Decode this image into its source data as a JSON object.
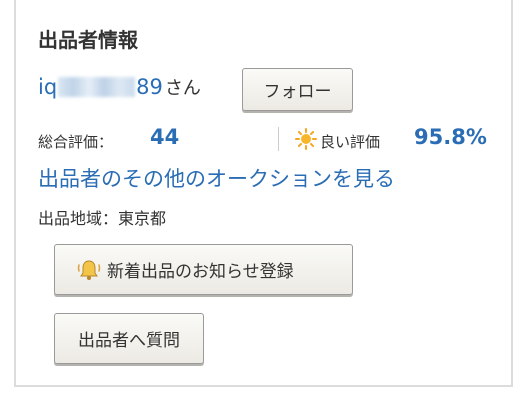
{
  "seller_info": {
    "title": "出品者情報",
    "seller_name_prefix": "iq",
    "seller_name_suffix": "89",
    "honorific": "さん",
    "follow_label": "フォロー",
    "total_rating_label": "総合評価：",
    "total_rating_value": "44",
    "good_rating_label": "良い評価",
    "good_rating_value": "95.8%",
    "other_auctions_link": "出品者のその他のオークションを見る",
    "region_text": "出品地域：東京都",
    "notify_button_label": "新着出品のお知らせ登録",
    "question_button_label": "出品者へ質問"
  },
  "icons": {
    "good_rating": "sun-icon",
    "notify": "bell-icon"
  },
  "colors": {
    "link": "#2a6db5",
    "text": "#333333",
    "border": "#dcdcdc",
    "sun": "#f5a623",
    "bell": "#e8b63a"
  }
}
